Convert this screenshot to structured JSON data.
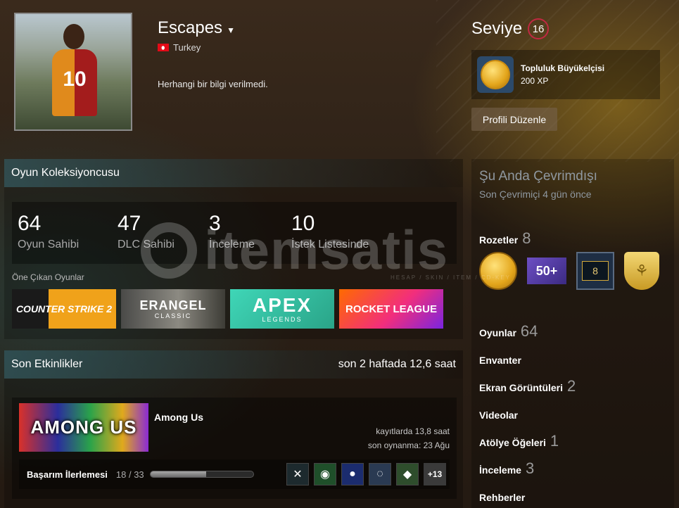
{
  "header": {
    "persona_name": "Escapes",
    "country": "Turkey",
    "summary": "Herhangi bir bilgi verilmedi.",
    "avatar_number": "10"
  },
  "level": {
    "label": "Seviye",
    "value": "16"
  },
  "featured_badge": {
    "name": "Topluluk Büyükelçisi",
    "xp": "200 XP"
  },
  "edit_profile_label": "Profili Düzenle",
  "collector": {
    "title": "Oyun Koleksiyoncusu",
    "stats": [
      {
        "value": "64",
        "label": "Oyun Sahibi"
      },
      {
        "value": "47",
        "label": "DLC Sahibi"
      },
      {
        "value": "3",
        "label": "İnceleme"
      },
      {
        "value": "10",
        "label": "İstek Listesinde"
      }
    ],
    "featured_label": "Öne Çıkan Oyunlar",
    "games": [
      {
        "title": "COUNTER STRIKE 2"
      },
      {
        "title": "ERANGEL",
        "subtitle": "CLASSIC"
      },
      {
        "title": "APEX",
        "subtitle": "LEGENDS"
      },
      {
        "title": "ROCKET LEAGUE"
      }
    ]
  },
  "activity": {
    "title": "Son Etkinlikler",
    "summary": "son 2 haftada 12,6 saat",
    "game": {
      "name": "Among Us",
      "cover_text": "AMONG US",
      "hours": "kayıtlarda 13,8 saat",
      "last_played": "son oynanma: 23 Ağu",
      "achievement_label": "Başarım İlerlemesi",
      "achievement_count": "18 / 33",
      "achievement_progress": 0.545,
      "more_achievements": "+13"
    }
  },
  "right_panel": {
    "status": "Şu Anda Çevrimdışı",
    "status_sub": "Son Çevrimiçi 4 gün önce",
    "badges_label": "Rozetler",
    "badges_count": "8",
    "badge_50_text": "50+",
    "badge_8_text": "8",
    "links": [
      {
        "label": "Oyunlar",
        "count": "64"
      },
      {
        "label": "Envanter",
        "count": ""
      },
      {
        "label": "Ekran Görüntüleri",
        "count": "2"
      },
      {
        "label": "Videolar",
        "count": ""
      },
      {
        "label": "Atölye Öğeleri",
        "count": "1"
      },
      {
        "label": "İnceleme",
        "count": "3"
      },
      {
        "label": "Rehberler",
        "count": ""
      }
    ]
  },
  "watermark": {
    "text": "itemsatis",
    "sub": "HESAP / SKIN / ITEM / CD-KEY"
  },
  "colors": {
    "level_ring": "#c02942",
    "offline_status": "#8f98a0",
    "showcase_header": "#3c6e78"
  }
}
